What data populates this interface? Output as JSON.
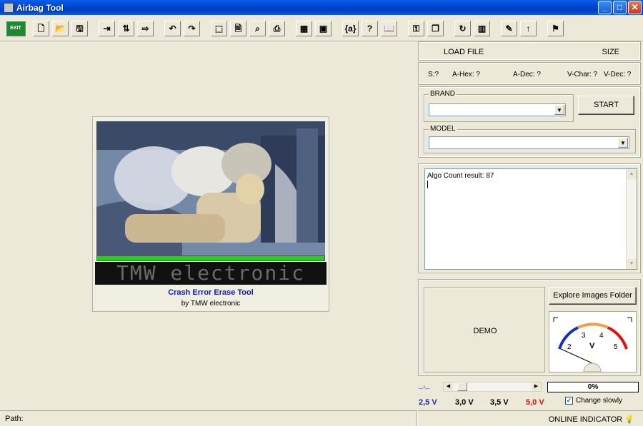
{
  "window": {
    "title": "Airbag Tool"
  },
  "toolbar": {
    "buttons": [
      {
        "name": "exit-button",
        "glyph": "EXIT"
      },
      {
        "name": "new-file-icon",
        "glyph": "🗋"
      },
      {
        "name": "open-folder-icon",
        "glyph": "📂"
      },
      {
        "name": "save-icon",
        "glyph": "🖫"
      },
      {
        "name": "import-icon",
        "glyph": "⇥"
      },
      {
        "name": "swap-icon",
        "glyph": "⇅"
      },
      {
        "name": "export-icon",
        "glyph": "⇨"
      },
      {
        "name": "undo-icon",
        "glyph": "↶"
      },
      {
        "name": "redo-icon",
        "glyph": "↷"
      },
      {
        "name": "select-icon",
        "glyph": "⬚"
      },
      {
        "name": "checksum-icon",
        "glyph": "🗎"
      },
      {
        "name": "find-icon",
        "glyph": "⌕"
      },
      {
        "name": "print-icon",
        "glyph": "⎙"
      },
      {
        "name": "calculator-icon",
        "glyph": "▦"
      },
      {
        "name": "chip-icon",
        "glyph": "▣"
      },
      {
        "name": "algo-icon",
        "glyph": "{a}"
      },
      {
        "name": "help-icon",
        "glyph": "?"
      },
      {
        "name": "manual-icon",
        "glyph": "📖"
      },
      {
        "name": "key-icon",
        "glyph": "⚿"
      },
      {
        "name": "copy-icon",
        "glyph": "❐"
      },
      {
        "name": "refresh-icon",
        "glyph": "↻"
      },
      {
        "name": "hex-view-icon",
        "glyph": "▥"
      },
      {
        "name": "new-entry-icon",
        "glyph": "✎"
      },
      {
        "name": "upload-icon",
        "glyph": "↑"
      },
      {
        "name": "wizard-icon",
        "glyph": "⚑"
      }
    ]
  },
  "splash": {
    "led_text": "TMW electronic",
    "title": "Crash Error Erase Tool",
    "subtitle": "by TMW electronic",
    "progress": 1.0
  },
  "file_panel": {
    "load_file_label": "LOAD FILE",
    "size_label": "SIZE"
  },
  "info_panel": {
    "s": "S:?",
    "a_hex": "A-Hex: ?",
    "a_dec": "A-Dec: ?",
    "v_char": "V-Char: ?",
    "v_dec": "V-Dec: ?"
  },
  "brand": {
    "label": "BRAND",
    "value": ""
  },
  "model": {
    "label": "MODEL",
    "value": ""
  },
  "start_button": "START",
  "memo": {
    "line1": "Algo Count result: 87"
  },
  "demo_label": "DEMO",
  "explore_button": "Explore Images Folder",
  "gauge": {
    "unit": "V",
    "ticks": [
      "2",
      "3",
      "4",
      "5"
    ]
  },
  "slider": {
    "label": "_._",
    "percent": "0%"
  },
  "voltages": [
    {
      "text": "2,5 V",
      "color": "#1a2fa8"
    },
    {
      "text": "3,0 V",
      "color": "#000000"
    },
    {
      "text": "3,5 V",
      "color": "#000000"
    },
    {
      "text": "5,0 V",
      "color": "#e01010"
    }
  ],
  "change_slowly": {
    "label": "Change slowly",
    "checked": true
  },
  "status": {
    "path": "Path:",
    "online": "ONLINE INDICATOR"
  }
}
